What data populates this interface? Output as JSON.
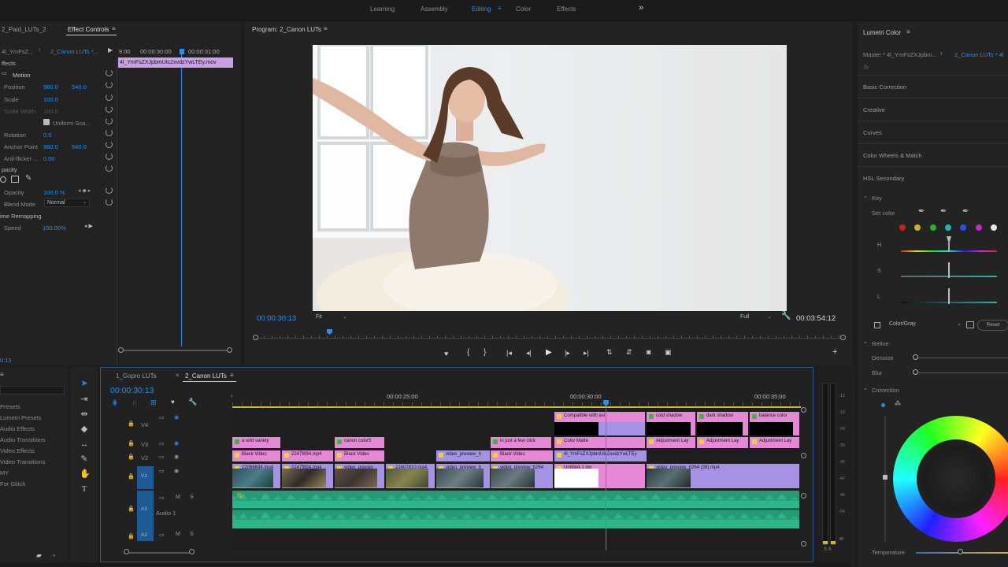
{
  "workspaces": {
    "items": [
      "Learning",
      "Assembly",
      "Editing",
      "Color",
      "Effects"
    ],
    "active": "Editing",
    "more": "»"
  },
  "effect_controls": {
    "source_tab": "2_Paid_LUTs_2",
    "tab": "Effect Controls",
    "source_label": "4l_YmFsZ...",
    "sequence_label": "2_Canon LUTs *...",
    "time_start": "9:00",
    "time_mid": "00:00:30:00",
    "time_end": "00:00:31:00",
    "clip_name": "4l_YmFsZXJpbmUtc2xvdzYwLTEy.mov",
    "section_effects": "ffects",
    "motion": "Motion",
    "position_label": "Position",
    "position_x": "960.0",
    "position_y": "540.0",
    "scale_label": "Scale",
    "scale_value": "100.0",
    "scale_width_label": "Scale Width",
    "scale_width_value": "100.0",
    "uniform_scale": "Uniform Sca...",
    "rotation_label": "Rotation",
    "rotation_value": "0.0",
    "anchor_label": "Anchor Point",
    "anchor_x": "960.0",
    "anchor_y": "540.0",
    "antiflicker_label": "Anti-flicker ...",
    "antiflicker_value": "0.00",
    "opacity_section": "pacity",
    "opacity_label": "Opacity",
    "opacity_value": "100.0 %",
    "blend_label": "Blend Mode",
    "blend_value": "Normal",
    "time_remap": "ime Remapping",
    "speed_label": "Speed",
    "speed_value": "100.00%",
    "bottom_time": "0:13"
  },
  "program": {
    "title": "Program: 2_Canon LUTs",
    "timecode": "00:00:30:13",
    "fit": "Fit",
    "quality": "Full",
    "duration": "00:03:54:12"
  },
  "lumetri": {
    "title": "Lumetri Color",
    "master": "Master * 4l_YmFsZXJpbm...",
    "sequence": "2_Canon LUTs * 4l",
    "fx": "fx",
    "sections": [
      "Basic Correction",
      "Creative",
      "Curves",
      "Color Wheels & Match",
      "HSL Secondary"
    ],
    "key": "Key",
    "set_color": "Set color",
    "h": "H",
    "s": "S",
    "l": "L",
    "color_gray": "Color/Gray",
    "reset": "Reset",
    "refine": "Refine",
    "denoise": "Denoise",
    "blur": "Blur",
    "correction": "Correction",
    "temperature": "Temperature",
    "swatches": [
      "#c81e1e",
      "#c8b41e",
      "#28b428",
      "#1eb4b4",
      "#2850e6",
      "#c828c8",
      "#e6e6e6"
    ]
  },
  "project": {
    "items": [
      "Presets",
      "Lumetri Presets",
      "Audio Effects",
      "Audio Transitions",
      "Video Effects",
      "Video Transitions",
      "MY",
      "For Glitch"
    ]
  },
  "timeline": {
    "tabs": [
      "1_Gopro LUTs",
      "2_Canon LUTs"
    ],
    "timecode": "00:00:30:13",
    "ruler": [
      "00:00:25:00",
      "00:00:30:00",
      "00:00:35:00"
    ],
    "tracks": [
      "V4",
      "V3",
      "V2",
      "V1",
      "A1",
      "A2"
    ],
    "audio_label": "Audio 1",
    "v4_clips": [
      "Compatible with avi",
      "cold shadow",
      "dark shadow",
      "balance color"
    ],
    "v3_clips": [
      "a wild variety",
      "canon color5",
      "in just a few click",
      "Color Matte",
      "Adjustment Lay",
      "Adjustment Lay",
      "Adjustment Lay"
    ],
    "v2_clips": [
      "Black Video",
      "2247f894.mp4",
      "Black Video",
      "video_preview_h",
      "Black Video",
      "4l_YmFsZXJpbmUtc2xvdzYwLTEy"
    ],
    "v1_clips": [
      "22066694.mp4",
      "2247f894.mp4",
      "video_previev",
      "22407810.mp4",
      "video_preview_h",
      "video_preview_h264",
      "Untitled-1.jpg",
      "video_preview_h264 (28).mp4"
    ],
    "meter_labels": [
      "-12",
      "-18",
      "-24",
      "-30",
      "-36",
      "-42",
      "-48",
      "-54",
      "dB"
    ],
    "meter_bottom": "S  S"
  }
}
